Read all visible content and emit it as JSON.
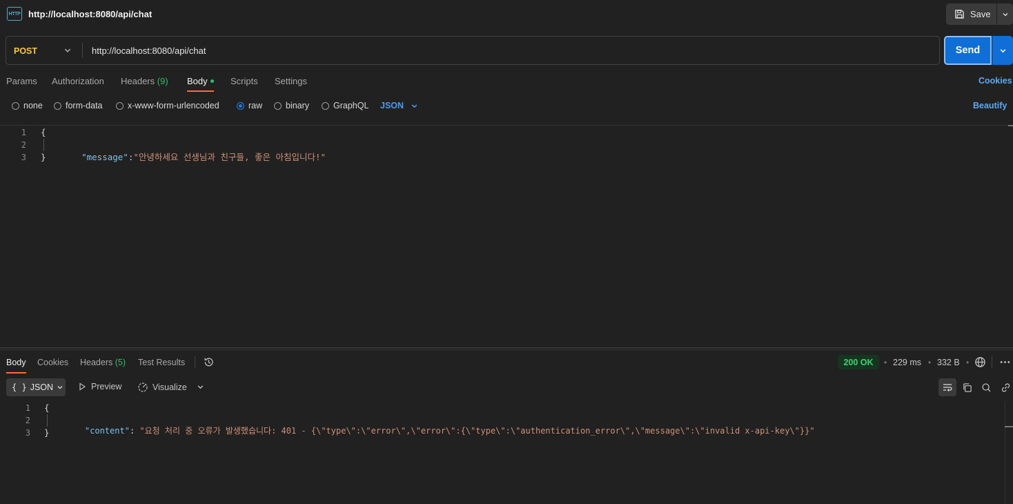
{
  "header": {
    "icon": "http-icon",
    "icon_text": "HTTP",
    "title": "http://localhost:8080/api/chat",
    "save_label": "Save"
  },
  "request": {
    "method": "POST",
    "url": "http://localhost:8080/api/chat",
    "send_label": "Send"
  },
  "request_tabs": {
    "params": "Params",
    "authorization": "Authorization",
    "headers": "Headers",
    "headers_count": "(9)",
    "body": "Body",
    "scripts": "Scripts",
    "settings": "Settings",
    "active": "Body"
  },
  "cookies_label": "Cookies",
  "body_types": {
    "none": "none",
    "form_data": "form-data",
    "urlencoded": "x-www-form-urlencoded",
    "raw": "raw",
    "binary": "binary",
    "graphql": "GraphQL",
    "selected": "raw",
    "format": "JSON"
  },
  "beautify_label": "Beautify",
  "request_body": {
    "line_numbers": [
      "1",
      "2",
      "3"
    ],
    "open": "{",
    "key": "\"message\"",
    "colon": ":",
    "value": "\"안녕하세요 선생님과 친구들, 좋은 아침입니다!\"",
    "close": "}"
  },
  "response_tabs": {
    "body": "Body",
    "cookies": "Cookies",
    "headers": "Headers",
    "headers_count": "(5)",
    "test_results": "Test Results",
    "active": "Body"
  },
  "response_meta": {
    "status": "200 OK",
    "time": "229 ms",
    "size": "332 B"
  },
  "response_toolbar": {
    "format": "JSON",
    "format_icon": "{ }",
    "preview": "Preview",
    "visualize": "Visualize"
  },
  "response_body": {
    "line_numbers": [
      "1",
      "2",
      "3"
    ],
    "open": "{",
    "key": "\"content\"",
    "colon": ": ",
    "value": "\"요청 처리 중 오류가 발생했습니다: 401 - {\\\"type\\\":\\\"error\\\",\\\"error\\\":{\\\"type\\\":\\\"authentication_error\\\",\\\"message\\\":\\\"invalid x-api-key\\\"}}\"",
    "close": "}"
  },
  "colors": {
    "accent": "#ff6c37",
    "send": "#0f6fd6",
    "method": "#f5c842",
    "status_ok": "#3ed07a",
    "link": "#5aaaf5"
  }
}
